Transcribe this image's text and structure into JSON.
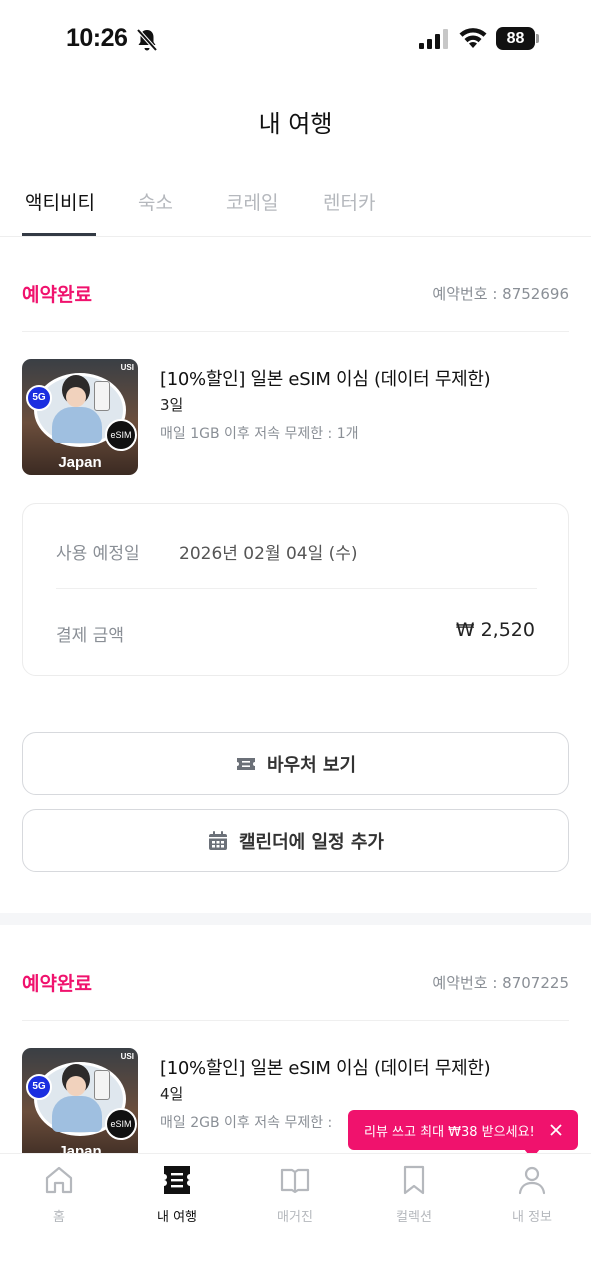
{
  "status_bar": {
    "time": "10:26",
    "battery": "88"
  },
  "page": {
    "title": "내 여행"
  },
  "tabs": [
    {
      "label": "액티비티",
      "active": true
    },
    {
      "label": "숙소",
      "active": false
    },
    {
      "label": "코레일",
      "active": false
    },
    {
      "label": "렌터카",
      "active": false
    }
  ],
  "bookings": [
    {
      "status": "예약완료",
      "booking_number": "예약번호 : 8752696",
      "thumb": {
        "country": "Japan",
        "badge_5g": "5G",
        "badge_esim": "eSIM",
        "brand": "USI"
      },
      "title": "[10%할인] 일본 eSIM 이심 (데이터 무제한)",
      "duration": "3일",
      "description": "매일 1GB 이후 저속 무제한 : 1개",
      "details": {
        "use_date_label": "사용 예정일",
        "use_date_value": "2026년 02월 04일 (수)",
        "amount_label": "결제 금액",
        "amount_value": "₩ 2,520"
      },
      "voucher_button": "바우처 보기",
      "calendar_button": "캘린더에 일정 추가"
    },
    {
      "status": "예약완료",
      "booking_number": "예약번호 : 8707225",
      "thumb": {
        "country": "Japan",
        "badge_5g": "5G",
        "badge_esim": "eSIM",
        "brand": "USI"
      },
      "title": "[10%할인] 일본 eSIM 이심 (데이터 무제한)",
      "duration": "4일",
      "description": "매일 2GB 이후 저속 무제한 :"
    }
  ],
  "review_tooltip": {
    "text": "리뷰 쓰고 최대 ₩38 받으세요!"
  },
  "bottom_nav": [
    {
      "label": "홈",
      "icon": "home-icon",
      "active": false
    },
    {
      "label": "내 여행",
      "icon": "ticket-icon",
      "active": true
    },
    {
      "label": "매거진",
      "icon": "book-icon",
      "active": false
    },
    {
      "label": "컬렉션",
      "icon": "bookmark-icon",
      "active": false
    },
    {
      "label": "내 정보",
      "icon": "person-icon",
      "active": false
    }
  ],
  "colors": {
    "accent": "#f0126d",
    "muted": "#8a8f96",
    "inactive": "#b5b8bd"
  }
}
